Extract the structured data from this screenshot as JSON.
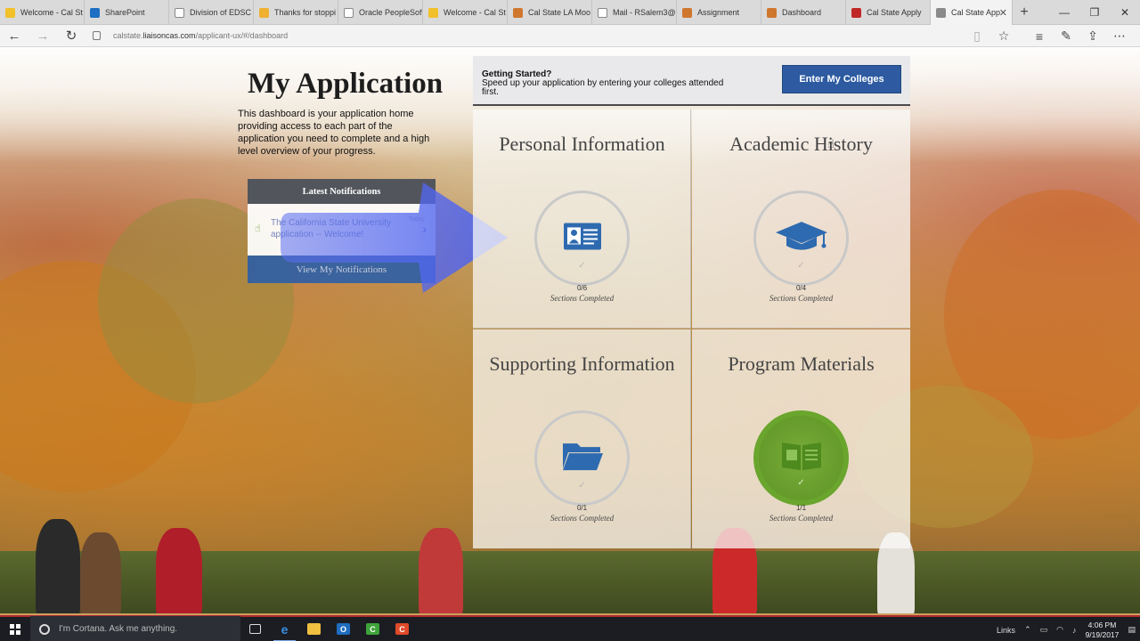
{
  "browser": {
    "tabs": [
      {
        "label": "Welcome - Cal St",
        "color": "#f2c028"
      },
      {
        "label": "SharePoint",
        "color": "#1e6fc2"
      },
      {
        "label": "Division of EDSC -",
        "color": "#9a9a9a"
      },
      {
        "label": "Thanks for stoppi",
        "color": "#f0b030"
      },
      {
        "label": "Oracle PeopleSoft",
        "color": "#9a9a9a"
      },
      {
        "label": "Welcome - Cal St",
        "color": "#f2c028"
      },
      {
        "label": "Cal State LA Moo",
        "color": "#d0772e"
      },
      {
        "label": "Mail - RSalem3@",
        "color": "#9a9a9a"
      },
      {
        "label": "Assignment",
        "color": "#d0772e"
      },
      {
        "label": "Dashboard",
        "color": "#d0772e"
      },
      {
        "label": "Cal State Apply",
        "color": "#c02828"
      },
      {
        "label": "Cal State App",
        "color": "#8a8a8a",
        "active": true
      }
    ],
    "url_prefix": "calstate.",
    "url_domain": "liaisoncas.com",
    "url_path": "/applicant-ux/#/dashboard"
  },
  "page": {
    "title": "My Application",
    "intro": "This dashboard is your application home providing access to each part of the application you need to complete and a high level overview of your progress.",
    "notifications": {
      "header": "Latest Notifications",
      "item_text": "The California State University application -- Welcome!",
      "item_date": "Today",
      "button": "View My Notifications"
    },
    "getting_started": {
      "title": "Getting Started?",
      "text": "Speed up your application by entering your colleges attended first.",
      "button": "Enter My Colleges"
    },
    "quadrants": [
      {
        "title": "Personal Information",
        "completed": 0,
        "total": 6,
        "count": "0/6",
        "caption": "Sections Completed",
        "icon": "id-card-icon",
        "done": false
      },
      {
        "title": "Academic History",
        "completed": 0,
        "total": 4,
        "count": "0/4",
        "caption": "Sections Completed",
        "icon": "graduation-cap-icon",
        "done": false
      },
      {
        "title": "Supporting Information",
        "completed": 0,
        "total": 1,
        "count": "0/1",
        "caption": "Sections Completed",
        "icon": "folder-icon",
        "done": false
      },
      {
        "title": "Program Materials",
        "completed": 1,
        "total": 1,
        "count": "1/1",
        "caption": "Sections Completed",
        "icon": "book-icon",
        "done": true
      }
    ],
    "colors": {
      "primary": "#2d5aa0",
      "complete": "#6aa52d",
      "notif_header": "#53555c"
    }
  },
  "taskbar": {
    "search_placeholder": "I'm Cortana. Ask me anything.",
    "links_label": "Links",
    "time": "4:06 PM",
    "date": "9/19/2017"
  }
}
